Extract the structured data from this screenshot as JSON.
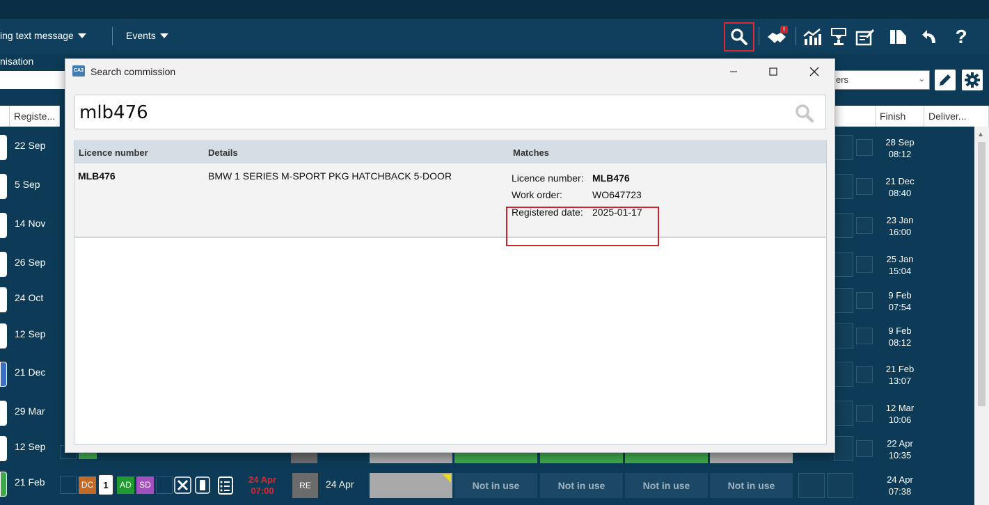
{
  "toolbar": {
    "menu_text_message": "ing text message",
    "menu_events": "Events"
  },
  "org_label": "nisation",
  "filter_select_value": "ers",
  "columns": {
    "registered": "Registe...",
    "finish": "Finish",
    "delivered": "Deliver..."
  },
  "rows_left": [
    "22 Sep",
    "5 Sep",
    "14 Nov",
    "26 Sep",
    "24 Oct",
    "12 Sep",
    "21 Dec",
    "29 Mar",
    "12 Sep",
    "21 Feb"
  ],
  "finish_times": [
    {
      "d": "28 Sep",
      "t": "08:12"
    },
    {
      "d": "21 Dec",
      "t": "08:40"
    },
    {
      "d": "23 Jan",
      "t": "16:00"
    },
    {
      "d": "25 Jan",
      "t": "15:04"
    },
    {
      "d": "9 Feb",
      "t": "07:54"
    },
    {
      "d": "9 Feb",
      "t": "08:12"
    },
    {
      "d": "21 Feb",
      "t": "13:07"
    },
    {
      "d": "12 Mar",
      "t": "10:06"
    },
    {
      "d": "22 Apr",
      "t": "10:35"
    },
    {
      "d": "24 Apr",
      "t": "07:38"
    }
  ],
  "last_row": {
    "badges": [
      "DC",
      "1",
      "AD",
      "SD"
    ],
    "badge_colors": [
      "#c36b26",
      "#ffffff",
      "#1e9a2e",
      "#a34fbf"
    ],
    "due_date": "24 Apr",
    "due_time": "07:00",
    "re_badge": "RE",
    "date": "24 Apr",
    "not_in_use": [
      "Not in use",
      "Not in use",
      "Not in use",
      "Not in use"
    ]
  },
  "dialog": {
    "logo_text": "CA3",
    "title": "Search commission",
    "search_value": "mlb476",
    "headers": {
      "licence": "Licence number",
      "details": "Details",
      "matches": "Matches"
    },
    "result": {
      "licence": "MLB476",
      "details": "BMW 1 SERIES M-SPORT PKG HATCHBACK 5-DOOR",
      "matches": [
        {
          "key": "Licence number:",
          "value": "MLB476"
        },
        {
          "key": "Work order:",
          "value": "WO647723"
        },
        {
          "key": "Registered date:",
          "value": "2025-01-17"
        }
      ]
    }
  }
}
